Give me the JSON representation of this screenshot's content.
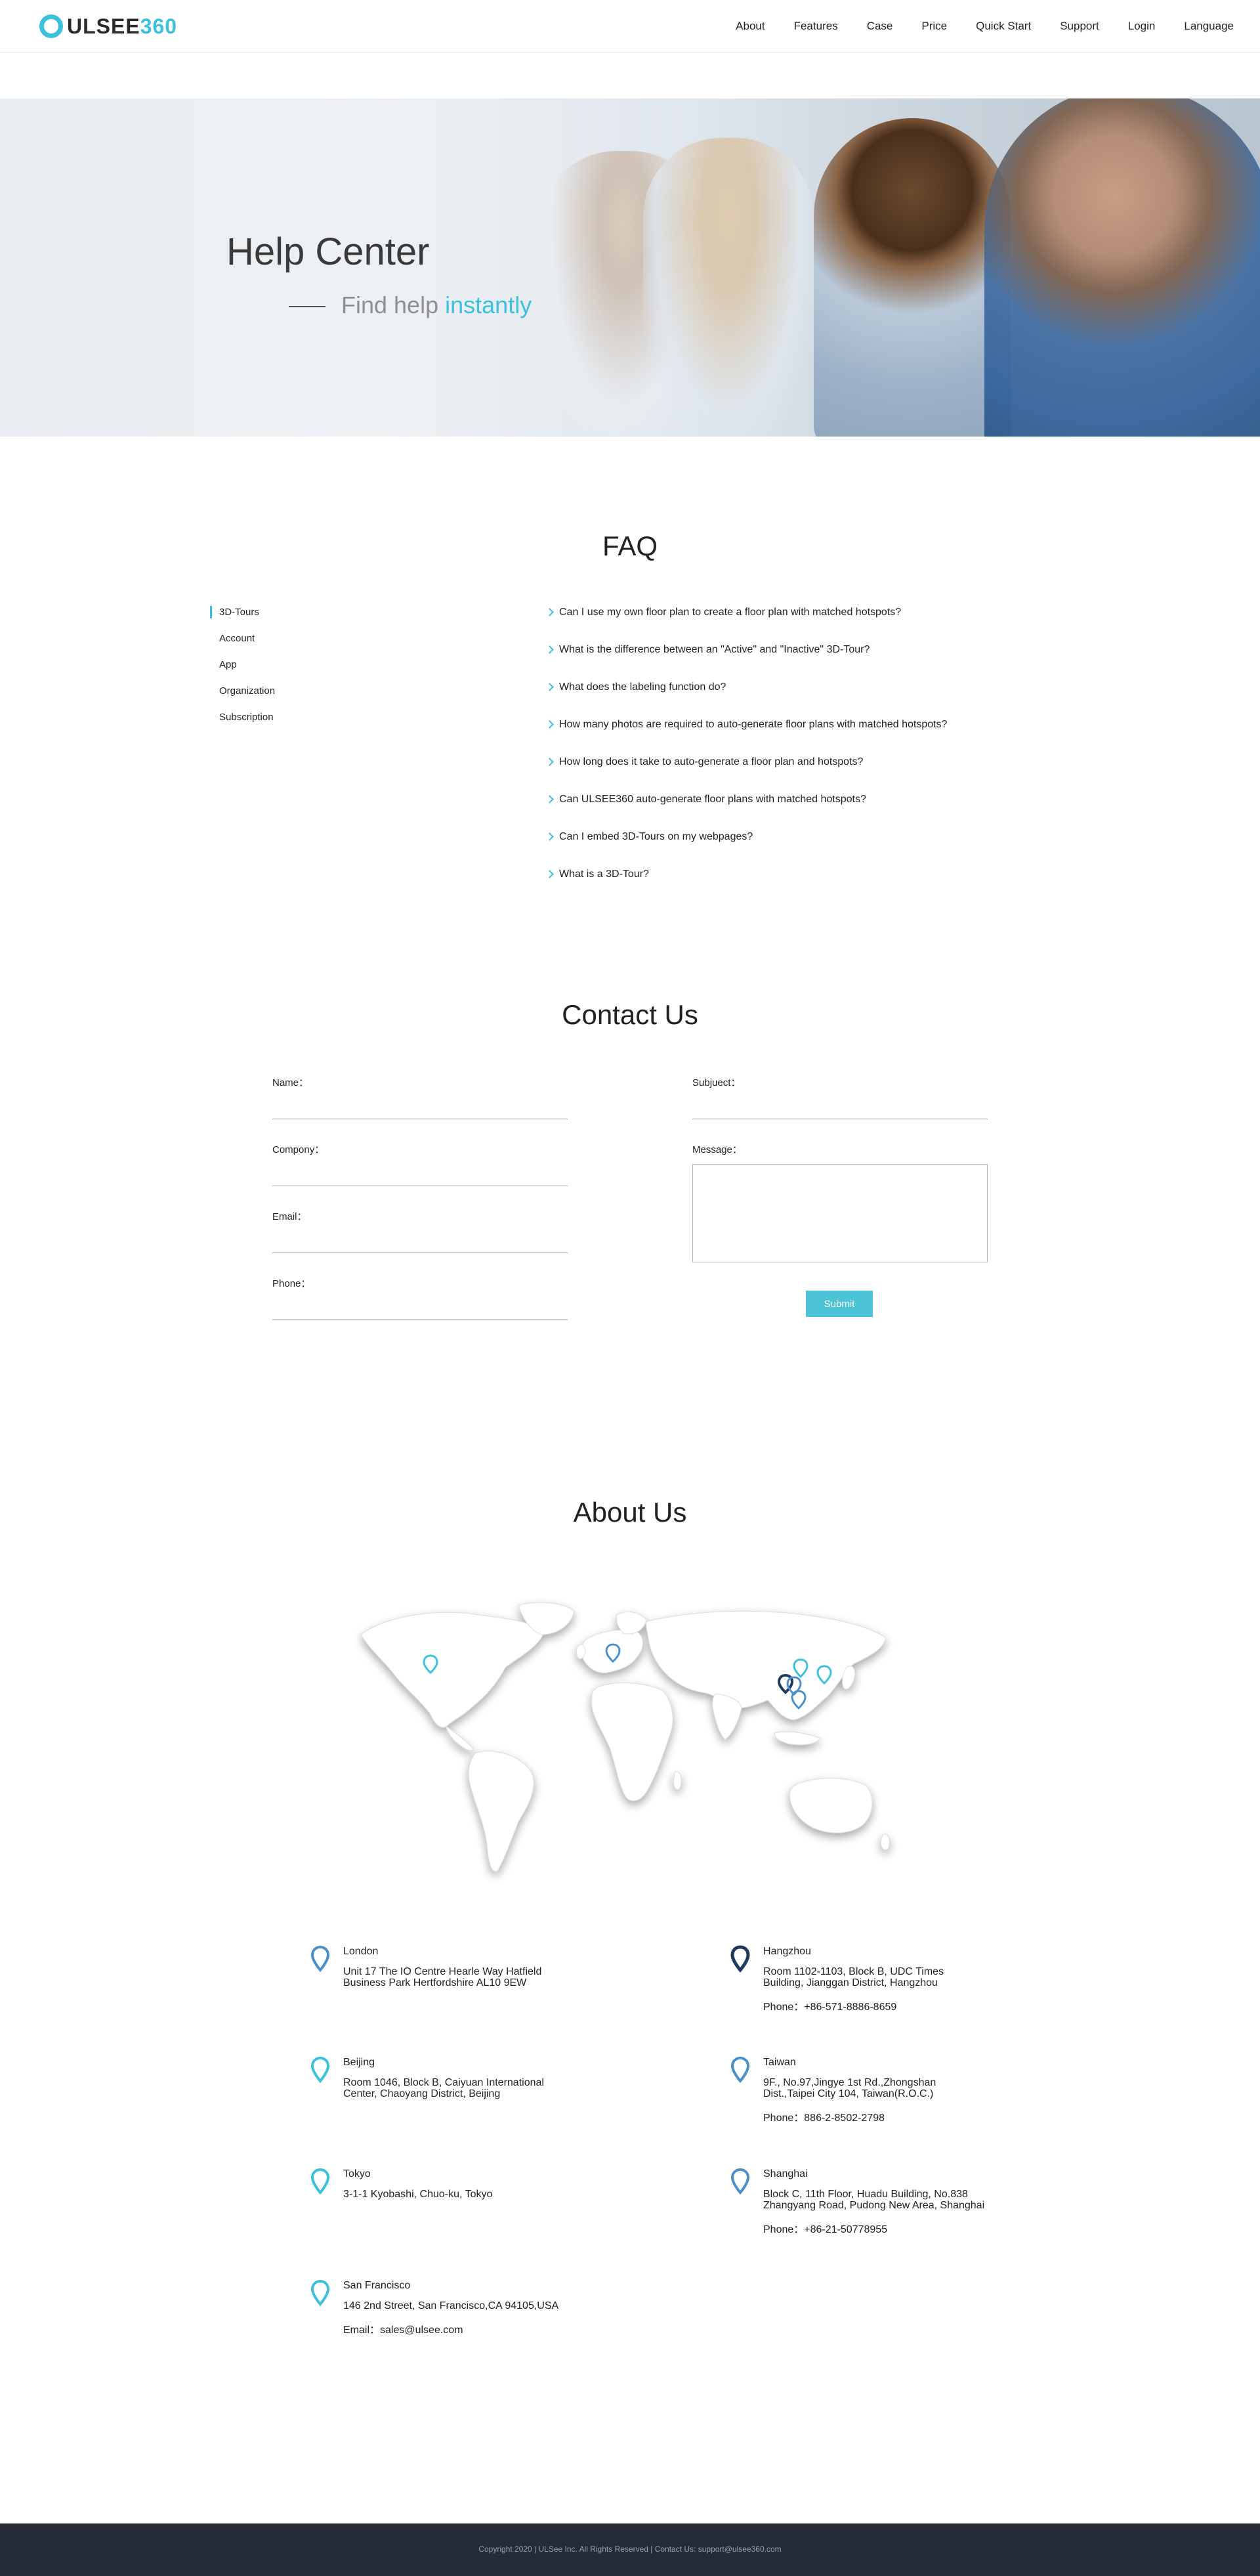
{
  "header": {
    "logo_text": "ULSEE",
    "logo_num": "360",
    "nav": [
      "About",
      "Features",
      "Case",
      "Price",
      "Quick Start",
      "Support",
      "Login",
      "Language"
    ]
  },
  "hero": {
    "title": "Help Center",
    "subtitle_prefix": "Find help",
    "subtitle_highlight": "instantly"
  },
  "faq": {
    "title": "FAQ",
    "categories": [
      "3D-Tours",
      "Account",
      "App",
      "Organization",
      "Subscription"
    ],
    "questions": [
      "Can I use my own floor plan to create a floor plan with matched hotspots?",
      "What is the difference between an \"Active\" and \"Inactive\" 3D-Tour?",
      "What does the labeling function do?",
      "How many photos are required to auto-generate floor plans with matched hotspots?",
      "How long does it take to auto-generate a floor plan and hotspots?",
      "Can ULSEE360 auto-generate floor plans with matched hotspots?",
      "Can I embed 3D-Tours on my webpages?",
      "What is a 3D-Tour?"
    ]
  },
  "contact": {
    "title": "Contact Us",
    "name_label": "Name：",
    "company_label": "Compony：",
    "email_label": "Email：",
    "phone_label": "Phone：",
    "subject_label": "Subjuect：",
    "message_label": "Message：",
    "submit": "Submit"
  },
  "about": {
    "title": "About Us",
    "offices": [
      {
        "name": "London",
        "address": "Unit 17 The IO Centre Hearle Way Hatfield Business Park Hertfordshire AL10 9EW",
        "contact": ""
      },
      {
        "name": "Hangzhou",
        "address": "Room 1102-1103, Block B, UDC Times Building, Jianggan District, Hangzhou",
        "contact": "Phone：+86-571-8886-8659"
      },
      {
        "name": "Beijing",
        "address": "Room 1046, Block B, Caiyuan International Center, Chaoyang District, Beijing",
        "contact": ""
      },
      {
        "name": "Taiwan",
        "address": "9F., No.97,Jingye 1st Rd.,Zhongshan Dist.,Taipei City 104, Taiwan(R.O.C.)",
        "contact": "Phone：886-2-8502-2798"
      },
      {
        "name": "Tokyo",
        "address": "3-1-1 Kyobashi, Chuo-ku, Tokyo",
        "contact": ""
      },
      {
        "name": "Shanghai",
        "address": "Block C, 11th Floor, Huadu Building, No.838 Zhangyang Road, Pudong New Area, Shanghai",
        "contact": "Phone：+86-21-50778955"
      },
      {
        "name": "San Francisco",
        "address": "146 2nd Street, San Francisco,CA 94105,USA",
        "contact": "Email：sales@ulsee.com"
      }
    ]
  },
  "footer": {
    "text": "Copyright 2020 | ULSee Inc. All Rights Reserved | Contact Us: support@ulsee360.com"
  },
  "colors": {
    "accent": "#3dc0dc",
    "pin_dark": "#1f3a5c",
    "pin_blue": "#4a8fc9",
    "footer_bg": "#262c37"
  }
}
